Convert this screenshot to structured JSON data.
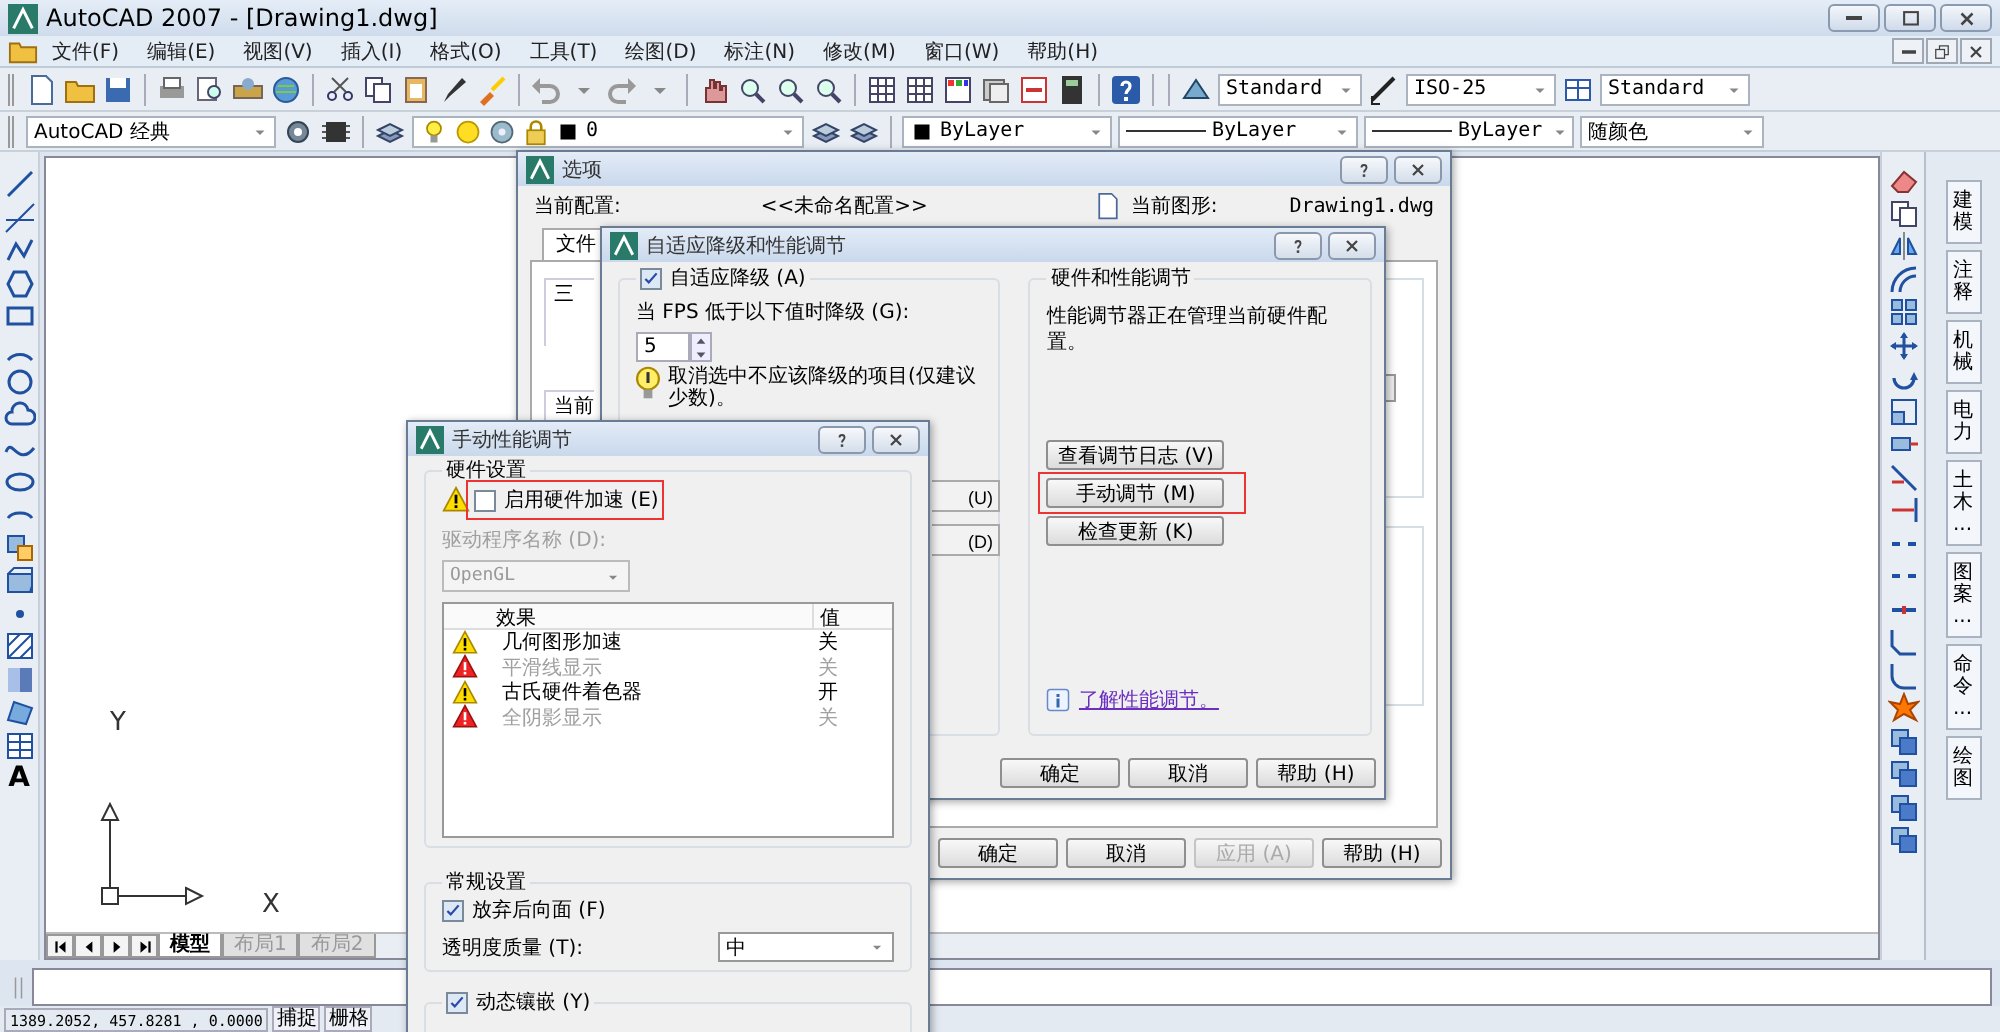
{
  "window": {
    "title": "AutoCAD 2007 - [Drawing1.dwg]"
  },
  "menu": [
    "文件(F)",
    "编辑(E)",
    "视图(V)",
    "插入(I)",
    "格式(O)",
    "工具(T)",
    "绘图(D)",
    "标注(N)",
    "修改(M)",
    "窗口(W)",
    "帮助(H)"
  ],
  "styles_toolbar": {
    "text_style": "Standard",
    "dim_style": "ISO-25",
    "table_style": "Standard"
  },
  "workspace": "AutoCAD 经典",
  "properties_toolbar": {
    "layer": "0",
    "color_control": "ByLayer",
    "linetype": "ByLayer",
    "lineweight": "ByLayer",
    "plot_style": "随颜色"
  },
  "draw_toolbar": {
    "text_tool": "A"
  },
  "canvas": {
    "ucs_x": "X",
    "ucs_y": "Y",
    "layout_tabs": [
      {
        "label": "模型",
        "selected": true
      },
      {
        "label": "布局1",
        "selected": false
      },
      {
        "label": "布局2",
        "selected": false
      }
    ]
  },
  "palette_tabs": [
    "建模",
    "注释",
    "机械",
    "电力",
    "土木...",
    "图案...",
    "命令...",
    "绘图"
  ],
  "status_bar": {
    "coordinates": "1389.2052, 457.8281 , 0.0000",
    "toggles": [
      "捕捉",
      "栅格"
    ]
  },
  "options_dialog": {
    "title": "选项",
    "profile_label": "当前配置:",
    "profile": "<<未命名配置>>",
    "drawing_label": "当前图形:",
    "drawing": "Drawing1.dwg",
    "tab": "文件",
    "group_labels": [
      "三",
      "当前"
    ],
    "buttons": [
      {
        "label": "确定",
        "disabled": false
      },
      {
        "label": "取消",
        "disabled": false
      },
      {
        "label": "应用 (A)",
        "disabled": true
      },
      {
        "label": "帮助 (H)",
        "disabled": false
      }
    ]
  },
  "adaptive_dialog": {
    "title": "自适应降级和性能调节",
    "degradation": {
      "label": "自适应降级 (A)",
      "checked": true
    },
    "fps_label": "当 FPS 低于以下值时降级 (G):",
    "fps_value": "5",
    "hint": "取消选中不应该降级的项目(仅建议少数)。",
    "side_buttons": [
      "(U)",
      "(D)"
    ],
    "tuning_title": "硬件和性能调节",
    "tuning_text": "性能调节器正在管理当前硬件配置。",
    "tuning_buttons": [
      {
        "label": "查看调节日志 (V)",
        "highlighted": false
      },
      {
        "label": "手动调节 (M)",
        "highlighted": true
      },
      {
        "label": "检查更新 (K)",
        "highlighted": false
      }
    ],
    "link": "了解性能调节。",
    "buttons": [
      "确定",
      "取消",
      "帮助 (H)"
    ]
  },
  "manual_dialog": {
    "title": "手动性能调节",
    "hardware_title": "硬件设置",
    "acceleration": {
      "label": "启用硬件加速 (E)",
      "checked": false,
      "highlighted": true
    },
    "driver": {
      "label": "驱动程序名称 (D):",
      "value": "OpenGL",
      "disabled": true
    },
    "columns": [
      "效果",
      "值"
    ],
    "effects": [
      {
        "kind": "warning",
        "name": "几何图形加速",
        "value": "关",
        "disabled": false
      },
      {
        "kind": "error",
        "name": "平滑线显示",
        "value": "关",
        "disabled": true
      },
      {
        "kind": "warning",
        "name": "古氏硬件着色器",
        "value": "开",
        "disabled": false
      },
      {
        "kind": "error",
        "name": "全阴影显示",
        "value": "关",
        "disabled": true
      }
    ],
    "general_title": "常规设置",
    "discard_backfaces": {
      "label": "放弃后向面 (F)",
      "checked": true
    },
    "transparency_label": "透明度质量 (T):",
    "transparency": "中",
    "tessellation": {
      "label": "动态镶嵌 (Y)",
      "checked": true
    }
  }
}
